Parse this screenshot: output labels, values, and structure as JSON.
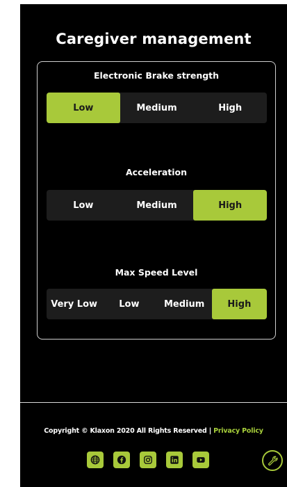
{
  "page": {
    "title": "Caregiver management"
  },
  "settings": [
    {
      "label": "Electronic Brake strength",
      "options": [
        "Low",
        "Medium",
        "High"
      ],
      "selected": "Low"
    },
    {
      "label": "Acceleration",
      "options": [
        "Low",
        "Medium",
        "High"
      ],
      "selected": "High"
    },
    {
      "label": "Max Speed Level",
      "options": [
        "Very Low",
        "Low",
        "Medium",
        "High"
      ],
      "selected": "High"
    }
  ],
  "footer": {
    "copyright": "Copyright © Klaxon 2020 All Rights Reserved | ",
    "privacy_link": "Privacy Policy",
    "social_icons": [
      "globe-icon",
      "facebook-icon",
      "instagram-icon",
      "linkedin-icon",
      "youtube-icon"
    ],
    "tool_icon": "wrench-icon"
  },
  "colors": {
    "accent": "#a8c93a",
    "background": "#000000",
    "segment": "#1d1d1d"
  }
}
